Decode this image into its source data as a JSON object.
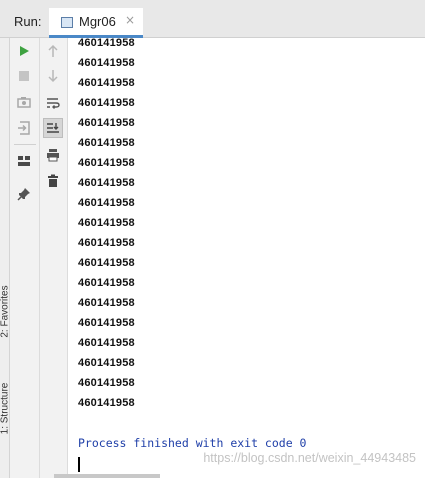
{
  "run_panel": {
    "label": "Run:",
    "tab_title": "Mgr06",
    "tab_close": "×"
  },
  "side_tabs": {
    "favorites": "2: Favorites",
    "structure": "1: Structure"
  },
  "toolbar_left": [
    "rerun-icon",
    "stop-icon",
    "camera-icon",
    "restore-layout-icon",
    "layout-icon",
    "pin-icon"
  ],
  "toolbar_right": [
    "up-arrow-icon",
    "down-arrow-icon",
    "soft-wrap-icon",
    "scroll-to-end-icon",
    "print-icon",
    "trash-icon"
  ],
  "console": {
    "output_lines": [
      "460141958",
      "460141958",
      "460141958",
      "460141958",
      "460141958",
      "460141958",
      "460141958",
      "460141958",
      "460141958",
      "460141958",
      "460141958",
      "460141958",
      "460141958",
      "460141958",
      "460141958",
      "460141958",
      "460141958",
      "460141958",
      "460141958"
    ],
    "exit_message": "Process finished with exit code 0"
  },
  "watermark": "https://blog.csdn.net/weixin_44943485",
  "colors": {
    "accent": "#4a88c7",
    "run_green": "#3ea241",
    "exit_text": "#1f3fa8"
  }
}
